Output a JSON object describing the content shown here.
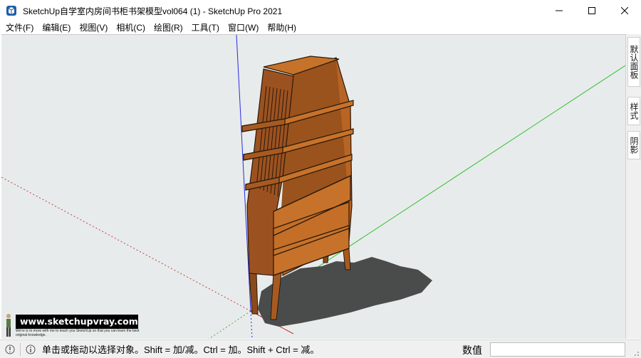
{
  "window": {
    "title": "SketchUp自学室内房间书柜书架模型vol064 (1) - SketchUp Pro 2021",
    "app_icon": "sketchup-logo-icon",
    "controls": [
      "minimize-icon",
      "maximize-icon",
      "close-icon"
    ]
  },
  "menu": {
    "items": [
      {
        "label": "文件(F)"
      },
      {
        "label": "编辑(E)"
      },
      {
        "label": "视图(V)"
      },
      {
        "label": "相机(C)"
      },
      {
        "label": "绘图(R)"
      },
      {
        "label": "工具(T)"
      },
      {
        "label": "窗口(W)"
      },
      {
        "label": "帮助(H)"
      }
    ]
  },
  "tray": {
    "tabs": [
      {
        "label": "默认面板"
      },
      {
        "label": "样式"
      },
      {
        "label": "阴影"
      }
    ]
  },
  "watermark": {
    "banner": "www.sketchupvray.com",
    "tagline": "We're is to more with me to teach you SketchUp so that you can learn the best original knowledge."
  },
  "status": {
    "hint": "单击或拖动以选择对象。Shift = 加/减。Ctrl = 加。Shift + Ctrl = 减。",
    "measure_label": "数值",
    "measure_value": ""
  },
  "colors": {
    "viewport_bg": "#e8ebeb",
    "axis_red": "#d03030",
    "axis_green": "#2ec02e",
    "axis_blue": "#2a2ae0",
    "wood_light": "#c7722a",
    "wood_dark": "#8a4a1c",
    "shadow": "#4a4c4c"
  }
}
